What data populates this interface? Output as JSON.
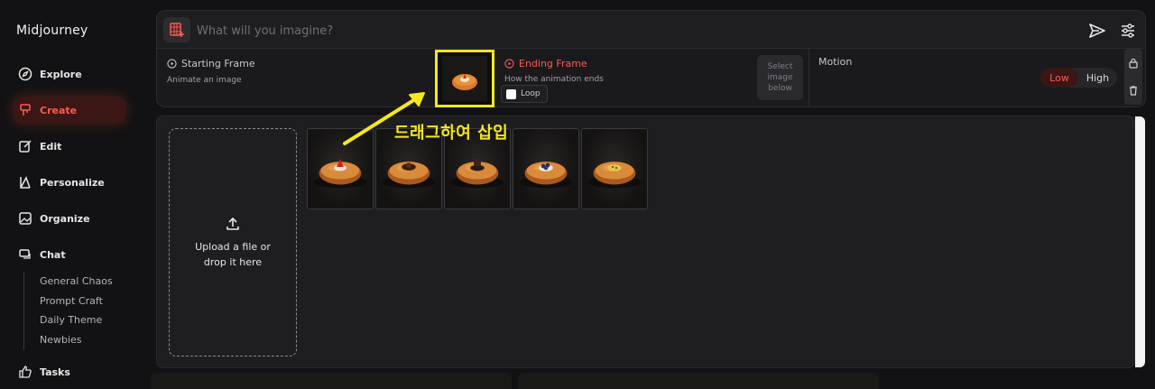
{
  "app": {
    "name": "Midjourney"
  },
  "nav": {
    "items": [
      {
        "label": "Explore",
        "icon": "compass-icon"
      },
      {
        "label": "Create",
        "icon": "brush-icon",
        "active": true
      },
      {
        "label": "Edit",
        "icon": "edit-icon"
      },
      {
        "label": "Personalize",
        "icon": "personalize-icon"
      },
      {
        "label": "Organize",
        "icon": "image-icon"
      },
      {
        "label": "Chat",
        "icon": "chat-icon"
      },
      {
        "label": "Tasks",
        "icon": "thumbs-up-icon"
      }
    ],
    "chat_rooms": [
      "General Chaos",
      "Prompt Craft",
      "Daily Theme",
      "Newbies"
    ]
  },
  "prompt": {
    "placeholder": "What will you imagine?"
  },
  "frames": {
    "starting_title": "Starting Frame",
    "starting_sub": "Animate an image",
    "ending_title": "Ending Frame",
    "ending_sub": "How the animation ends",
    "loop_label": "Loop",
    "select_below": "Select image below"
  },
  "motion": {
    "label": "Motion",
    "low": "Low",
    "high": "High",
    "selected": "Low"
  },
  "upload": {
    "text": "Upload a file or drop it here"
  },
  "annotation": {
    "text": "드래그하여 삽입"
  },
  "colors": {
    "accent": "#ff5a4b",
    "highlight": "#f5e71b",
    "background": "#121214"
  },
  "thumbnails": [
    {
      "topping": "strawberry"
    },
    {
      "topping": "chocolate"
    },
    {
      "topping": "chocolate-square"
    },
    {
      "topping": "blueberry"
    },
    {
      "topping": "custard"
    }
  ]
}
